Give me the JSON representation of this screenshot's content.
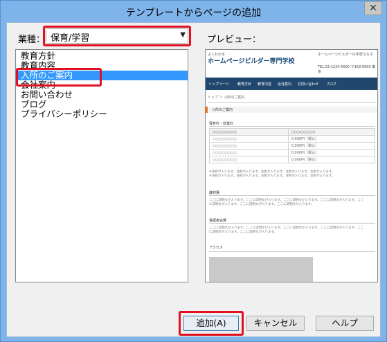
{
  "window": {
    "title": "テンプレートからページの追加",
    "close_glyph": "✕"
  },
  "category": {
    "label": "業種：",
    "value": "保育/学習"
  },
  "preview": {
    "label": "プレビュー："
  },
  "pages": [
    {
      "label": "教育方針",
      "selected": false
    },
    {
      "label": "教育内容",
      "selected": false
    },
    {
      "label": "入所のご案内",
      "selected": true
    },
    {
      "label": "会社案内",
      "selected": false
    },
    {
      "label": "お問い合わせ",
      "selected": false
    },
    {
      "label": "ブログ",
      "selected": false
    },
    {
      "label": "プライバシーポリシー",
      "selected": false
    }
  ],
  "preview_page": {
    "catch": "よくわかる",
    "logo": "ホームページビルダー専門学校",
    "top_right": "ホームページビルダーの学習ならホ",
    "tel": "TEL.03-1234-0000 〒163-0000 東京",
    "nav": [
      "トップページ",
      "教育方針",
      "教育内容",
      "会社案内",
      "お問い合わせ",
      "ブログ"
    ],
    "breadcrumb": "トップ ＞ 入所のご案内",
    "heading": "入所のご案内",
    "fee_title": "保育料・授業料",
    "table_head": [
      "○○○○○○○○",
      "○○○○○○○○"
    ],
    "table_rows": [
      [
        "○○○○○○○○",
        "0,000円［税込］"
      ],
      [
        "○○○○○○○○",
        "0,000円［税込］"
      ],
      [
        "○○○○○○○○",
        "0,000円［税込］"
      ],
      [
        "○○○○○○○○",
        "0,000円［税込］"
      ]
    ],
    "notes": [
      "※注釈が入ります。注釈が入ります。注釈が入ります。注釈が入ります。注釈が入ります。",
      "※注釈が入ります。注釈が入ります。注釈が入ります。注釈が入ります。注釈が入ります。"
    ],
    "materials_title": "教材費",
    "materials_text": [
      "ここに説明文が入ります。ここに説明文が入ります。ここに説明文が入ります。ここに説明文が入ります。ここ",
      "に説明文が入ります。ここに説明文が入ります。ここに説明文が入ります。"
    ],
    "parents_title": "保護者会費",
    "parents_text": [
      "ここに説明文が入ります。ここに説明文が入ります。ここに説明文が入ります。ここに説明文が入ります。ここ",
      "に説明文が入ります。ここに説明文が入ります。"
    ],
    "access_title": "アクセス"
  },
  "buttons": {
    "add": "追加(A)",
    "cancel": "キャンセル",
    "help": "ヘルプ"
  },
  "colors": {
    "titlebar": "#7eb4ea",
    "selection": "#3399ff",
    "highlight_box": "#e01020",
    "preview_nav": "#21476e",
    "preview_accent": "#f07820"
  }
}
